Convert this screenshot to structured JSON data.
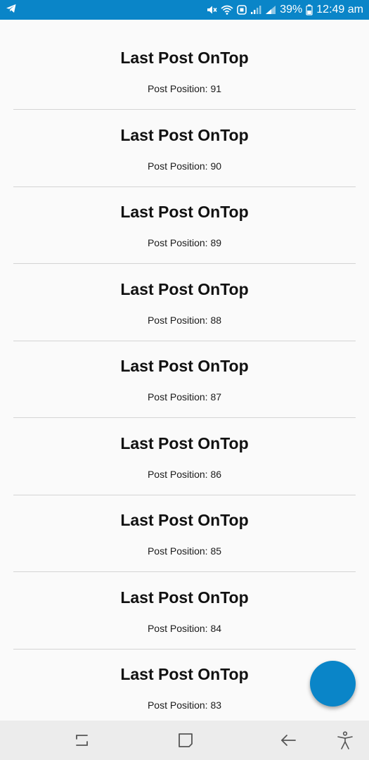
{
  "status_bar": {
    "app_icon": "telegram-icon",
    "status_icons": [
      "mute-icon",
      "wifi-icon",
      "data-saver-icon",
      "signal-icon",
      "signal-icon",
      "battery-icon"
    ],
    "battery_percent": "39%",
    "time": "12:49 am",
    "color": "#0a85c8"
  },
  "posts": [
    {
      "title": "Last Post OnTop",
      "subtitle": "Post Position: 91"
    },
    {
      "title": "Last Post OnTop",
      "subtitle": "Post Position: 90"
    },
    {
      "title": "Last Post OnTop",
      "subtitle": "Post Position: 89"
    },
    {
      "title": "Last Post OnTop",
      "subtitle": "Post Position: 88"
    },
    {
      "title": "Last Post OnTop",
      "subtitle": "Post Position: 87"
    },
    {
      "title": "Last Post OnTop",
      "subtitle": "Post Position: 86"
    },
    {
      "title": "Last Post OnTop",
      "subtitle": "Post Position: 85"
    },
    {
      "title": "Last Post OnTop",
      "subtitle": "Post Position: 84"
    },
    {
      "title": "Last Post OnTop",
      "subtitle": "Post Position: 83"
    }
  ],
  "fab": {
    "color": "#0a85c8"
  },
  "nav_bar": {
    "buttons": [
      "recent-apps-icon",
      "home-icon",
      "back-icon",
      "accessibility-icon"
    ]
  }
}
